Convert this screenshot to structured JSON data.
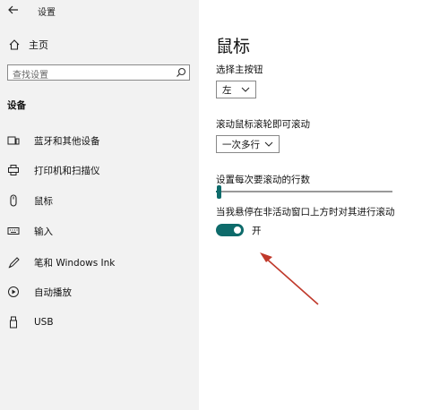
{
  "window": {
    "title": "设置"
  },
  "sidebar": {
    "home_label": "主页",
    "search_placeholder": "查找设置",
    "section_title": "设备",
    "items": [
      {
        "label": "蓝牙和其他设备",
        "icon": "bluetooth-devices-icon"
      },
      {
        "label": "打印机和扫描仪",
        "icon": "printer-icon"
      },
      {
        "label": "鼠标",
        "icon": "mouse-icon",
        "selected": true
      },
      {
        "label": "输入",
        "icon": "keyboard-icon"
      },
      {
        "label": "笔和 Windows Ink",
        "icon": "pen-icon"
      },
      {
        "label": "自动播放",
        "icon": "autoplay-icon"
      },
      {
        "label": "USB",
        "icon": "usb-icon"
      }
    ]
  },
  "main": {
    "title": "鼠标",
    "primary_button": {
      "label": "选择主按钮",
      "value": "左"
    },
    "wheel_scroll": {
      "label": "滚动鼠标滚轮即可滚动",
      "value": "一次多行"
    },
    "lines_to_scroll": {
      "label": "设置每次要滚动的行数",
      "level": 0.02
    },
    "inactive_scroll": {
      "label": "当我悬停在非活动窗口上方时对其进行滚动",
      "state": "开"
    }
  },
  "colors": {
    "accent": "#0e6b6b",
    "annotation": "#c0392b"
  }
}
